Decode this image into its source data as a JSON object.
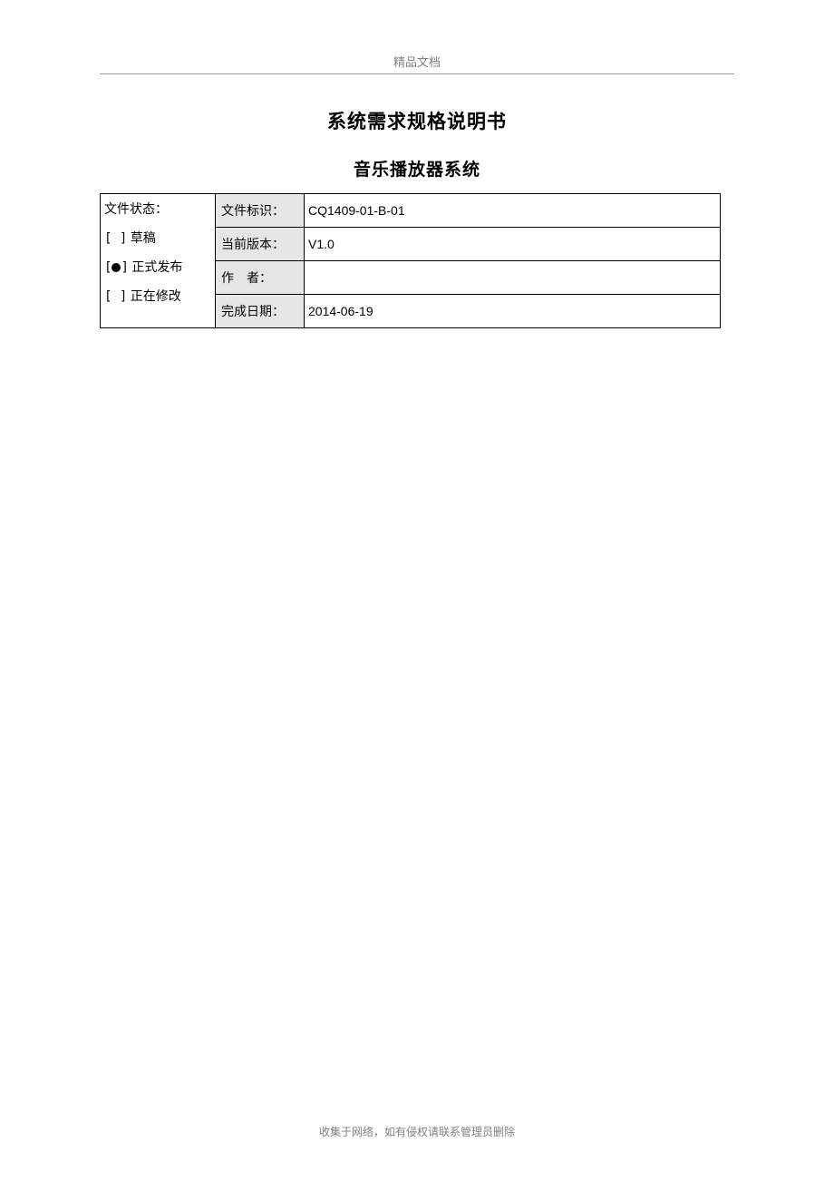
{
  "header": {
    "text": "精品文档"
  },
  "titles": {
    "main": "系统需求规格说明书",
    "sub": "音乐播放器系统"
  },
  "status": {
    "heading": "文件状态：",
    "options": [
      {
        "marker": "[  ]",
        "label": "草稿",
        "filled": false
      },
      {
        "marker": "[●]",
        "label": "正式发布",
        "filled": true
      },
      {
        "marker": "[  ]",
        "label": "正在修改",
        "filled": false
      }
    ]
  },
  "fields": [
    {
      "label": "文件标识：",
      "value": "CQ1409-01-B-01"
    },
    {
      "label": "当前版本：",
      "value": "V1.0"
    },
    {
      "label": "作　者：",
      "value": ""
    },
    {
      "label": "完成日期：",
      "value": "2014-06-19"
    }
  ],
  "footer": {
    "text": "收集于网络，如有侵权请联系管理员删除"
  }
}
